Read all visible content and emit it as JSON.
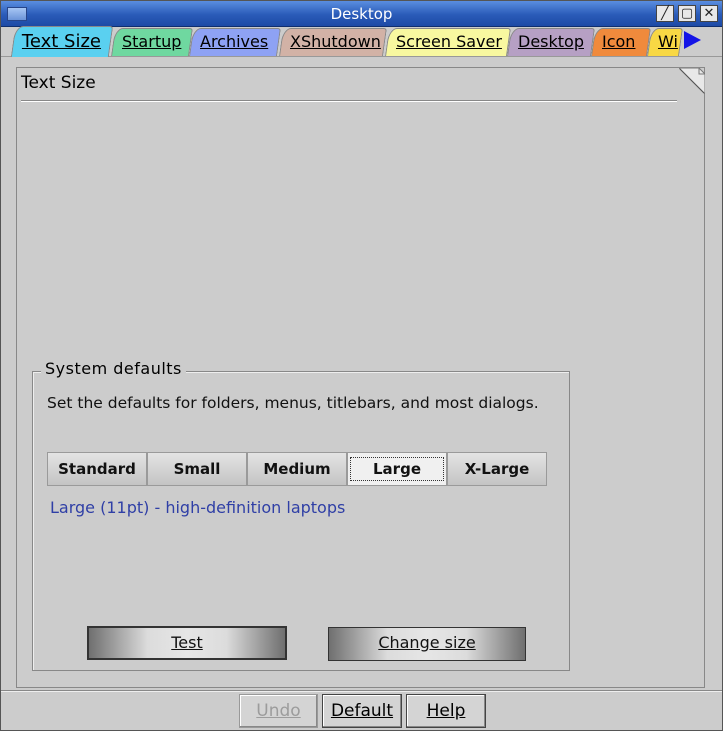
{
  "window": {
    "title": "Desktop"
  },
  "tabs": [
    {
      "label": "Text Size",
      "color": "#5ad0f0",
      "active": true
    },
    {
      "label": "Startup",
      "color": "#6fd8a0"
    },
    {
      "label": "Archives",
      "color": "#8ea2f4"
    },
    {
      "label": "XShutdown",
      "color": "#d2b2a6"
    },
    {
      "label": "Screen Saver",
      "color": "#f8f8a0"
    },
    {
      "label": "Desktop",
      "color": "#b6a0c4"
    },
    {
      "label": "Icon",
      "color": "#f08a3c"
    },
    {
      "label": "Wi",
      "color": "#f8d844"
    }
  ],
  "page": {
    "title": "Text Size"
  },
  "system_defaults": {
    "title": "System defaults",
    "description": "Set the defaults for folders, menus, titlebars, and most dialogs.",
    "sizes": [
      "Standard",
      "Small",
      "Medium",
      "Large",
      "X-Large"
    ],
    "selected_size": "Large",
    "selected_description": "Large (11pt) - high-definition laptops",
    "test_label": "Test",
    "change_size_label": "Change size"
  },
  "footer": {
    "undo_label": "Undo",
    "default_label": "Default",
    "help_label": "Help"
  }
}
